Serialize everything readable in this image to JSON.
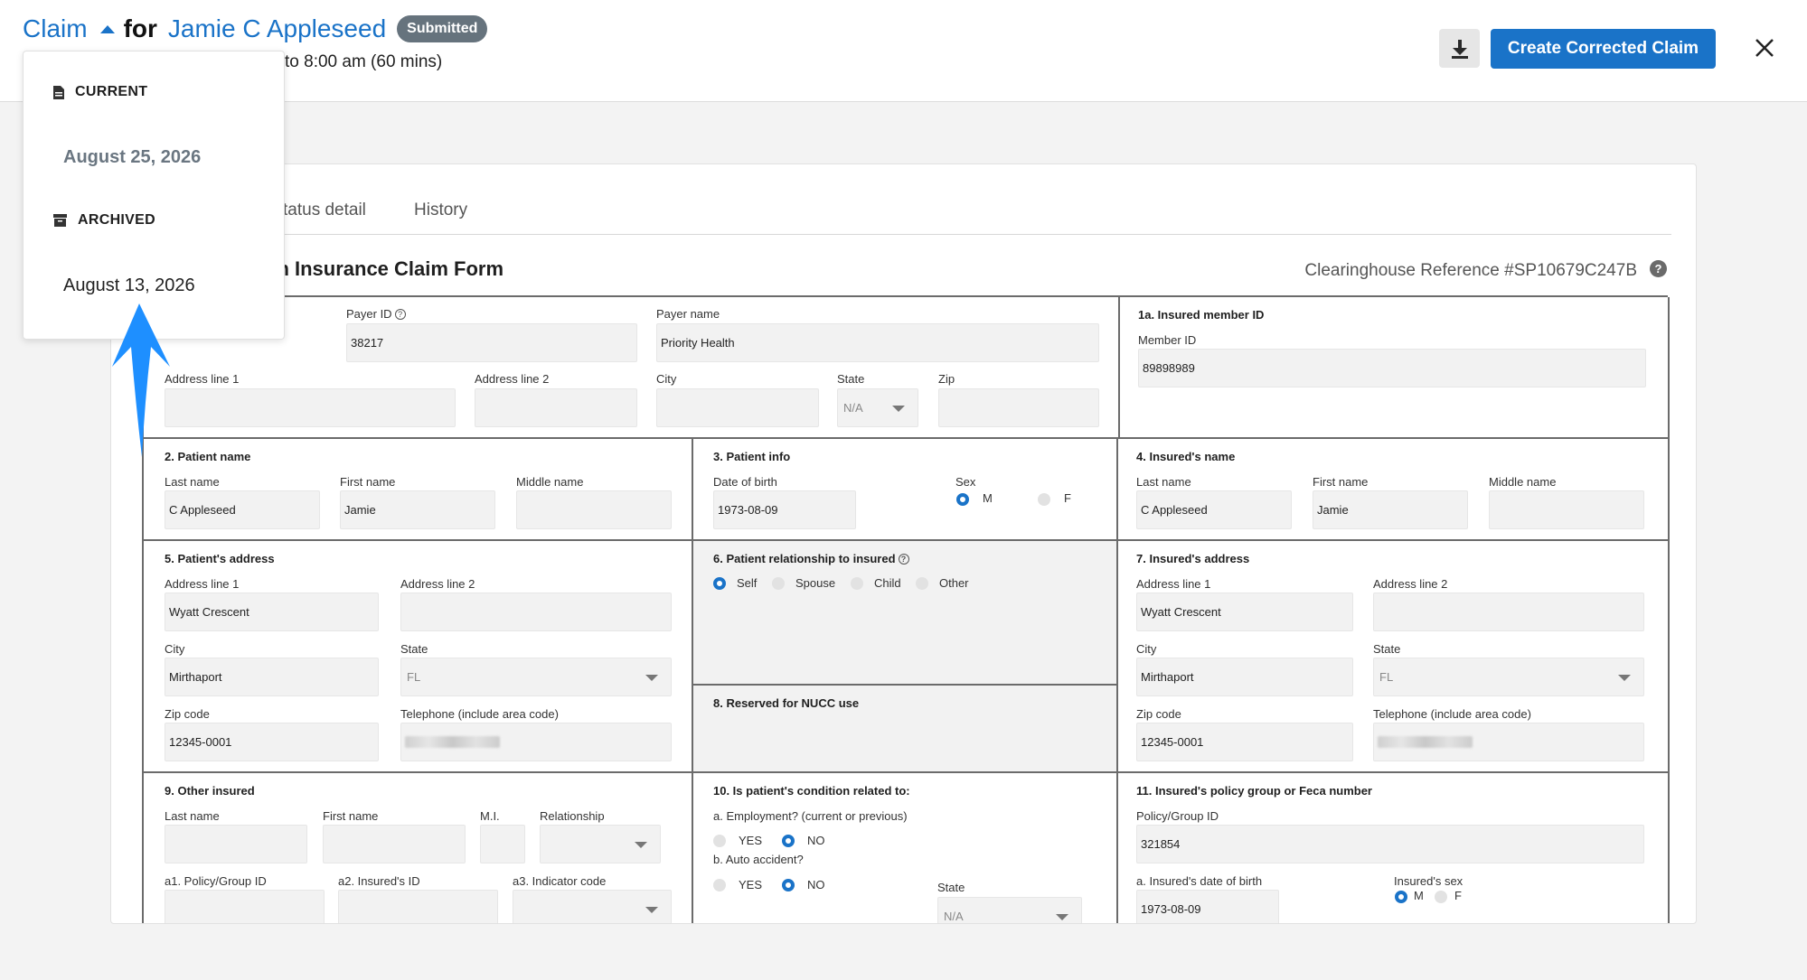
{
  "header": {
    "claim_label": "Claim",
    "for_label": "for",
    "patient_name": "Jamie C Appleseed",
    "status_badge": "Submitted",
    "time_text": "to 8:00 am (60 mins)",
    "create_button": "Create Corrected Claim",
    "download_icon": "download-icon",
    "close_icon": "close-icon"
  },
  "tabs": [
    {
      "label": "tatus detail"
    },
    {
      "label": "History"
    }
  ],
  "form": {
    "title": "lth Insurance Claim Form",
    "clearinghouse_ref": "Clearinghouse Reference #SP10679C247B",
    "payer": {
      "payer_id_label": "Payer ID",
      "payer_id": "38217",
      "payer_name_label": "Payer name",
      "payer_name": "Priority Health",
      "addr1_label": "Address line 1",
      "addr2_label": "Address line 2",
      "city_label": "City",
      "state_label": "State",
      "state_value": "N/A",
      "zip_label": "Zip"
    },
    "insured_member": {
      "title": "1a. Insured member ID",
      "member_id_label": "Member ID",
      "member_id": "89898989"
    },
    "patient_name": {
      "title": "2. Patient name",
      "last_label": "Last name",
      "last": "C Appleseed",
      "first_label": "First name",
      "first": "Jamie",
      "middle_label": "Middle name"
    },
    "patient_info": {
      "title": "3. Patient info",
      "dob_label": "Date of birth",
      "dob": "1973-08-09",
      "sex_label": "Sex",
      "m": "M",
      "f": "F"
    },
    "insured_name": {
      "title": "4. Insured's name",
      "last_label": "Last name",
      "last": "C Appleseed",
      "first_label": "First name",
      "first": "Jamie",
      "middle_label": "Middle name"
    },
    "patient_address": {
      "title": "5. Patient's address",
      "addr1_label": "Address line 1",
      "addr1": "Wyatt Crescent",
      "addr2_label": "Address line 2",
      "city_label": "City",
      "city": "Mirthaport",
      "state_label": "State",
      "state": "FL",
      "zip_label": "Zip code",
      "zip": "12345-0001",
      "phone_label": "Telephone (include area code)"
    },
    "relationship": {
      "title": "6. Patient relationship to insured",
      "options": [
        "Self",
        "Spouse",
        "Child",
        "Other"
      ]
    },
    "nucc": {
      "title": "8. Reserved for NUCC use"
    },
    "insured_address": {
      "title": "7. Insured's address",
      "addr1_label": "Address line 1",
      "addr1": "Wyatt Crescent",
      "addr2_label": "Address line 2",
      "city_label": "City",
      "city": "Mirthaport",
      "state_label": "State",
      "state": "FL",
      "zip_label": "Zip code",
      "zip": "12345-0001",
      "phone_label": "Telephone (include area code)"
    },
    "other_insured": {
      "title": "9. Other insured",
      "last_label": "Last name",
      "first_label": "First name",
      "mi_label": "M.I.",
      "relationship_label": "Relationship",
      "a1_label": "a1. Policy/Group ID",
      "a2_label": "a2. Insured's ID",
      "a3_label": "a3. Indicator code"
    },
    "condition": {
      "title": "10. Is patient's condition related to:",
      "employment_label": "a. Employment? (current or previous)",
      "auto_label": "b. Auto accident?",
      "yes": "YES",
      "no": "NO",
      "state_label": "State",
      "state_value": "N/A"
    },
    "policy_group": {
      "title": "11. Insured's policy group or Feca number",
      "policy_label": "Policy/Group ID",
      "policy": "321854",
      "dob_label": "a. Insured's date of birth",
      "dob": "1973-08-09",
      "sex_label": "Insured's sex",
      "m": "M",
      "f": "F"
    }
  },
  "popup": {
    "current_label": "CURRENT",
    "current_date": "August 25, 2026",
    "archived_label": "ARCHIVED",
    "archived_date": "August 13, 2026"
  },
  "colors": {
    "accent": "#1a73c8",
    "badge": "#66737d",
    "annotation_arrow": "#1e8fff"
  }
}
